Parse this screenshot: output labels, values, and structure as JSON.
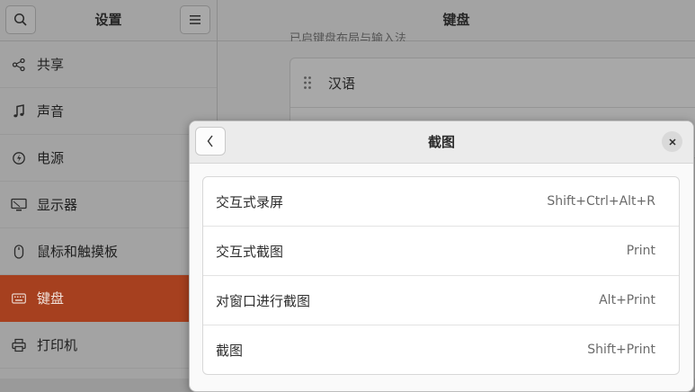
{
  "sidebar": {
    "title": "设置",
    "items": [
      {
        "label": "共享",
        "icon": "share-icon"
      },
      {
        "label": "声音",
        "icon": "music-note-icon"
      },
      {
        "label": "电源",
        "icon": "power-icon"
      },
      {
        "label": "显示器",
        "icon": "display-icon"
      },
      {
        "label": "鼠标和触摸板",
        "icon": "mouse-icon"
      },
      {
        "label": "键盘",
        "icon": "keyboard-icon",
        "active": true
      },
      {
        "label": "打印机",
        "icon": "printer-icon"
      }
    ]
  },
  "main": {
    "title": "键盘",
    "partial_text": "已启键盘布局与输入法",
    "input_sources": [
      {
        "label": "汉语"
      }
    ]
  },
  "dialog": {
    "title": "截图",
    "shortcuts": [
      {
        "label": "交互式录屏",
        "accel": "Shift+Ctrl+Alt+R"
      },
      {
        "label": "交互式截图",
        "accel": "Print"
      },
      {
        "label": "对窗口进行截图",
        "accel": "Alt+Print"
      },
      {
        "label": "截图",
        "accel": "Shift+Print"
      }
    ]
  },
  "colors": {
    "accent": "#a6401f",
    "dim_background": "#a3a3a3",
    "dialog_background": "#fafafa"
  }
}
